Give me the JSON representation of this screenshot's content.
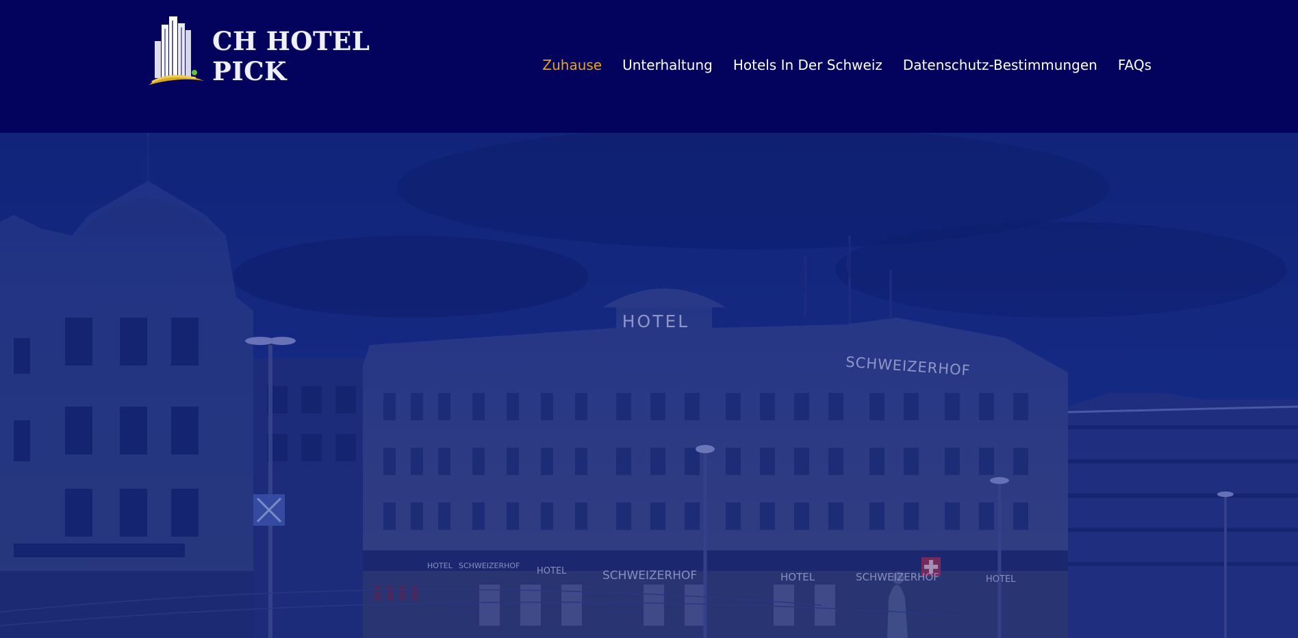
{
  "brand": {
    "name": "CH HOTEL PICK",
    "logo_icon": "hotel-tower-icon"
  },
  "nav": {
    "items": [
      {
        "label": "Zuhause",
        "active": true
      },
      {
        "label": "Unterhaltung",
        "active": false
      },
      {
        "label": "Hotels In Der Schweiz",
        "active": false
      },
      {
        "label": "Datenschutz-Bestimmungen",
        "active": false
      },
      {
        "label": "FAQs",
        "active": false
      }
    ]
  },
  "hero": {
    "signs": {
      "hotel_top": "HOTEL",
      "schweizerhof_top": "SCHWEIZERHOF",
      "awning": [
        "HOTEL",
        "SCHWEIZERHOF",
        "HOTEL",
        "SCHWEIZERHOF",
        "HOTEL",
        "SCHWEIZERHOF",
        "HOTEL"
      ]
    }
  },
  "colors": {
    "header_bg": "#03025c",
    "nav_text": "#ffffff",
    "nav_active": "#e8a51b",
    "hero_overlay": "#0b1a7a"
  }
}
